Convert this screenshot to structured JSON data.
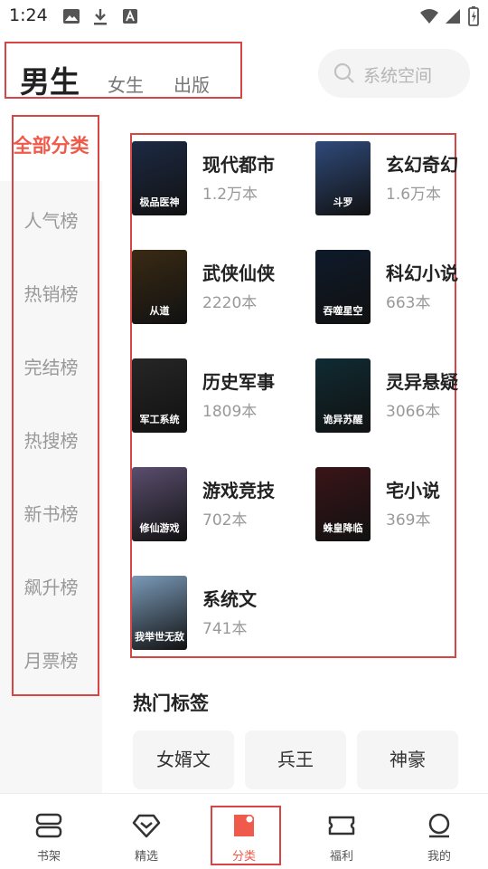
{
  "status_bar": {
    "time": "1:24"
  },
  "top_tabs": [
    {
      "label": "男生",
      "selected": true
    },
    {
      "label": "女生",
      "selected": false
    },
    {
      "label": "出版",
      "selected": false
    }
  ],
  "search": {
    "placeholder": "系统空间"
  },
  "sidebar": {
    "items": [
      {
        "label": "全部分类",
        "active": true
      },
      {
        "label": "人气榜"
      },
      {
        "label": "热销榜"
      },
      {
        "label": "完结榜"
      },
      {
        "label": "热搜榜"
      },
      {
        "label": "新书榜"
      },
      {
        "label": "飙升榜"
      },
      {
        "label": "月票榜"
      }
    ]
  },
  "categories": [
    {
      "name": "现代都市",
      "count": "1.2万本",
      "cover_text": "极品医神",
      "cover_color": "#1d2a44"
    },
    {
      "name": "玄幻奇幻",
      "count": "1.6万本",
      "cover_text": "斗罗",
      "cover_color": "#2f4a7a"
    },
    {
      "name": "武侠仙侠",
      "count": "2220本",
      "cover_text": "从道",
      "cover_color": "#3a2a14"
    },
    {
      "name": "科幻小说",
      "count": "663本",
      "cover_text": "吞噬星空",
      "cover_color": "#0e1a2a"
    },
    {
      "name": "历史军事",
      "count": "1809本",
      "cover_text": "军工系统",
      "cover_color": "#262626"
    },
    {
      "name": "灵异悬疑",
      "count": "3066本",
      "cover_text": "诡异苏醒",
      "cover_color": "#0f2b33"
    },
    {
      "name": "游戏竞技",
      "count": "702本",
      "cover_text": "修仙游戏",
      "cover_color": "#5a4e6e"
    },
    {
      "name": "宅小说",
      "count": "369本",
      "cover_text": "蛛皇降临",
      "cover_color": "#3a1418"
    },
    {
      "name": "系统文",
      "count": "741本",
      "cover_text": "我举世无敌",
      "cover_color": "#7a9ab8"
    }
  ],
  "hot_tags": {
    "title": "热门标签",
    "tags": [
      "女婿文",
      "兵王",
      "神豪"
    ]
  },
  "bottom_nav": [
    {
      "label": "书架",
      "icon": "bookshelf-icon"
    },
    {
      "label": "精选",
      "icon": "diamond-icon"
    },
    {
      "label": "分类",
      "icon": "category-icon",
      "active": true
    },
    {
      "label": "福利",
      "icon": "ticket-icon"
    },
    {
      "label": "我的",
      "icon": "profile-icon"
    }
  ],
  "colors": {
    "accent": "#f05a4b",
    "highlight_box": "#d84545"
  }
}
